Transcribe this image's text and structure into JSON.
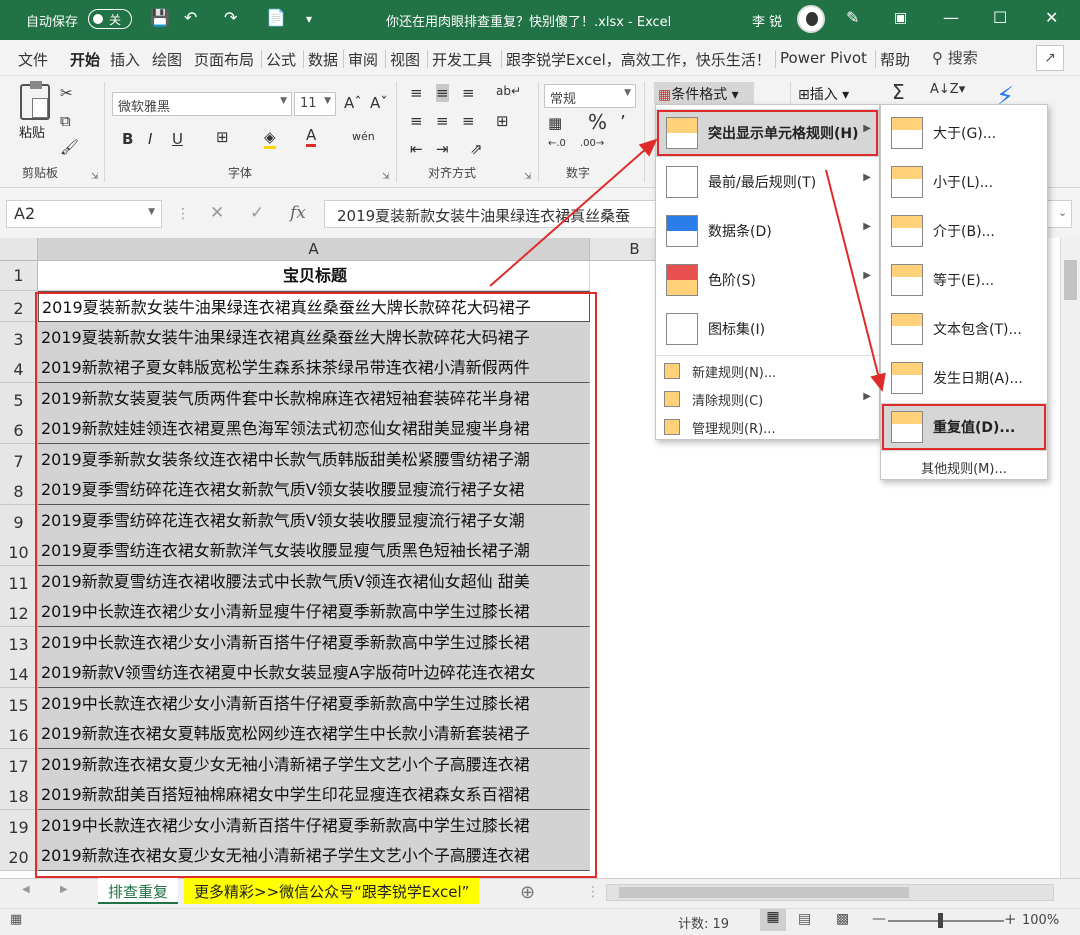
{
  "titlebar": {
    "autosave_label": "自动保存",
    "autosave_state": "关",
    "doc_title": "你还在用肉眼排查重复？快别傻了！.xlsx - Excel",
    "user_name": "李 锐"
  },
  "menu": {
    "tabs": [
      "文件",
      "开始",
      "插入",
      "绘图",
      "页面布局",
      "公式",
      "数据",
      "审阅",
      "视图",
      "开发工具",
      "跟李锐学Excel，高效工作，快乐生活！",
      "Power Pivot",
      "帮助"
    ],
    "active_tab": "开始",
    "search_label": "搜索"
  },
  "ribbon": {
    "paste_label": "粘贴",
    "font_name": "微软雅黑",
    "font_size": "11",
    "number_format": "常规",
    "cond_format_label": "条件格式",
    "insert_label": "插入",
    "groups": {
      "clipboard": "剪贴板",
      "font": "字体",
      "alignment": "对齐方式",
      "number": "数字"
    }
  },
  "formula_bar": {
    "name_box": "A2",
    "fx": "fx",
    "content": "2019夏装新款女装牛油果绿连衣裙真丝桑蚕"
  },
  "sheet": {
    "col_a": "A",
    "col_b": "B",
    "header": "宝贝标题",
    "rows": [
      "2019夏装新款女装牛油果绿连衣裙真丝桑蚕丝大牌长款碎花大码裙子",
      "2019夏装新款女装牛油果绿连衣裙真丝桑蚕丝大牌长款碎花大码裙子",
      "2019新款裙子夏女韩版宽松学生森系抹茶绿吊带连衣裙小清新假两件",
      "2019新款女装夏装气质两件套中长款棉麻连衣裙短袖套装碎花半身裙",
      "2019新款娃娃领连衣裙夏黑色海军领法式初恋仙女裙甜美显瘦半身裙",
      "2019夏季新款女装条纹连衣裙中长款气质韩版甜美松紧腰雪纺裙子潮",
      "2019夏季雪纺碎花连衣裙女新款气质V领女装收腰显瘦流行裙子女裙",
      "2019夏季雪纺碎花连衣裙女新款气质V领女装收腰显瘦流行裙子女潮",
      "2019夏季雪纺连衣裙女新款洋气女装收腰显瘦气质黑色短袖长裙子潮",
      "2019新款夏雪纺连衣裙收腰法式中长款气质V领连衣裙仙女超仙 甜美",
      "2019中长款连衣裙少女小清新显瘦牛仔裙夏季新款高中学生过膝长裙",
      "2019中长款连衣裙少女小清新百搭牛仔裙夏季新款高中学生过膝长裙",
      "2019新款V领雪纺连衣裙夏中长款女装显瘦A字版荷叶边碎花连衣裙女",
      "2019中长款连衣裙少女小清新百搭牛仔裙夏季新款高中学生过膝长裙",
      "2019新款连衣裙女夏韩版宽松网纱连衣裙学生中长款小清新套装裙子",
      "2019新款连衣裙女夏少女无袖小清新裙子学生文艺小个子高腰连衣裙",
      "2019新款甜美百搭短袖棉麻裙女中学生印花显瘦连衣裙森女系百褶裙",
      "2019中长款连衣裙少女小清新百搭牛仔裙夏季新款高中学生过膝长裙",
      "2019新款连衣裙女夏少女无袖小清新裙子学生文艺小个子高腰连衣裙"
    ]
  },
  "cf_menu": {
    "items": [
      {
        "label": "突出显示单元格规则(H)",
        "icon": "highlight-rules-icon"
      },
      {
        "label": "最前/最后规则(T)",
        "icon": "top-bottom-icon"
      },
      {
        "label": "数据条(D)",
        "icon": "data-bars-icon"
      },
      {
        "label": "色阶(S)",
        "icon": "color-scales-icon"
      },
      {
        "label": "图标集(I)",
        "icon": "icon-sets-icon"
      }
    ],
    "small_items": [
      "新建规则(N)...",
      "清除规则(C)",
      "管理规则(R)..."
    ]
  },
  "sub_menu": {
    "items": [
      "大于(G)...",
      "小于(L)...",
      "介于(B)...",
      "等于(E)...",
      "文本包含(T)...",
      "发生日期(A)...",
      "重复值(D)..."
    ],
    "other": "其他规则(M)..."
  },
  "tabs": {
    "sheet1": "排查重复",
    "sheet2": "更多精彩>>微信公众号“跟李锐学Excel”"
  },
  "status": {
    "count": "计数: 19",
    "zoom": "100%"
  },
  "colors": {
    "excel_green": "#217346",
    "highlight_red": "#e02b2b",
    "selection_gray": "#d3d3d3",
    "tab_yellow": "#ffff00"
  }
}
